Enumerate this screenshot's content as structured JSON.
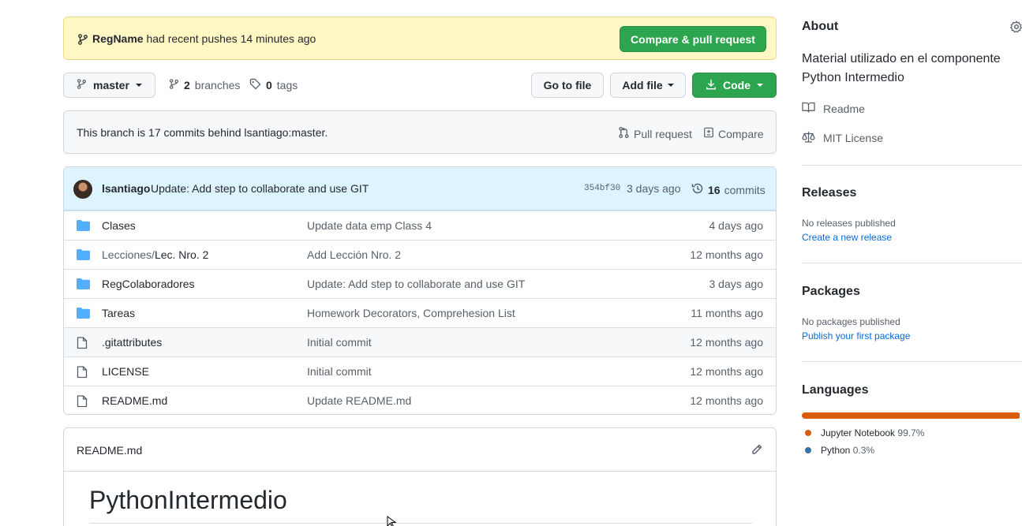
{
  "flash": {
    "user": "RegName",
    "text": "had recent pushes 14 minutes ago",
    "button": "Compare & pull request"
  },
  "branchbar": {
    "branch": "master",
    "branches_count": "2",
    "branches_label": "branches",
    "tags_count": "0",
    "tags_label": "tags",
    "go_to_file": "Go to file",
    "add_file": "Add file",
    "code": "Code"
  },
  "behind": {
    "text": "This branch is 17 commits behind lsantiago:master.",
    "pull_request": "Pull request",
    "compare": "Compare"
  },
  "latest_commit": {
    "author": "lsantiago",
    "message": "Update: Add step to collaborate and use GIT",
    "sha": "354bf30",
    "when": "3 days ago",
    "count": "16",
    "count_label": "commits"
  },
  "files": [
    {
      "type": "dir",
      "prefix": "",
      "name": "Clases",
      "message": "Update data emp Class 4",
      "age": "4 days ago"
    },
    {
      "type": "dir",
      "prefix": "Lecciones/",
      "name": "Lec. Nro. 2",
      "message": "Add Lección Nro. 2",
      "age": "12 months ago"
    },
    {
      "type": "dir",
      "prefix": "",
      "name": "RegColaboradores",
      "message": "Update: Add step to collaborate and use GIT",
      "age": "3 days ago"
    },
    {
      "type": "dir",
      "prefix": "",
      "name": "Tareas",
      "message": "Homework Decorators, Comprehesion List",
      "age": "11 months ago"
    },
    {
      "type": "file",
      "prefix": "",
      "name": ".gitattributes",
      "message": "Initial commit",
      "age": "12 months ago"
    },
    {
      "type": "file",
      "prefix": "",
      "name": "LICENSE",
      "message": "Initial commit",
      "age": "12 months ago"
    },
    {
      "type": "file",
      "prefix": "",
      "name": "README.md",
      "message": "Update README.md",
      "age": "12 months ago"
    }
  ],
  "readme": {
    "filename": "README.md",
    "heading": "PythonIntermedio"
  },
  "about": {
    "title": "About",
    "description": "Material utilizado en el componente Python Intermedio",
    "readme": "Readme",
    "license": "MIT License"
  },
  "releases": {
    "title": "Releases",
    "none": "No releases published",
    "create": "Create a new release"
  },
  "packages": {
    "title": "Packages",
    "none": "No packages published",
    "publish": "Publish your first package"
  },
  "languages": {
    "title": "Languages",
    "items": [
      {
        "name": "Jupyter Notebook",
        "percent": "99.7%",
        "value": 99.7,
        "color": "#DA5B0B"
      },
      {
        "name": "Python",
        "percent": "0.3%",
        "value": 0.3,
        "color": "#3572A5"
      }
    ]
  },
  "colors": {
    "accent_green": "#2da44e",
    "link_blue": "#0969da",
    "flash_bg": "#fff8c5",
    "folder_blue": "#54aeff"
  }
}
